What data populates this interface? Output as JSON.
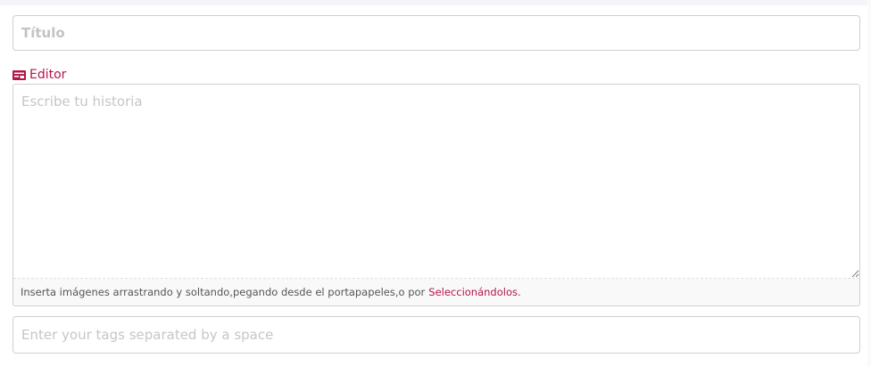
{
  "form": {
    "title_field": {
      "value": "",
      "placeholder": "Título"
    },
    "editor": {
      "label": "Editor",
      "icon": "editor-card-icon",
      "textarea": {
        "value": "",
        "placeholder": "Escribe tu historia"
      },
      "upload_hint": {
        "text": "Inserta imágenes arrastrando y soltando,pegando desde el portapapeles,o por",
        "link_label": "Seleccionándolos."
      }
    },
    "tags_field": {
      "value": "",
      "placeholder": "Enter your tags separated by a space"
    }
  },
  "colors": {
    "accent": "#b51546",
    "border": "#cfcfcf",
    "placeholder": "#c6c6c6",
    "hint_background": "#f9f9f9"
  }
}
